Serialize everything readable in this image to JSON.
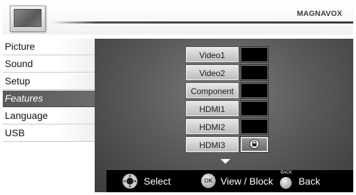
{
  "header": {
    "brand": "MAGNAVOX",
    "tv_icon": "tv-icon"
  },
  "menu": {
    "items": [
      {
        "label": "Picture",
        "selected": false
      },
      {
        "label": "Sound",
        "selected": false
      },
      {
        "label": "Setup",
        "selected": false
      },
      {
        "label": "Features",
        "selected": true
      },
      {
        "label": "Language",
        "selected": false
      },
      {
        "label": "USB",
        "selected": false
      }
    ]
  },
  "sources": {
    "items": [
      {
        "label": "Video1",
        "blocked": false
      },
      {
        "label": "Video2",
        "blocked": false
      },
      {
        "label": "Component",
        "blocked": false
      },
      {
        "label": "HDMI1",
        "blocked": false
      },
      {
        "label": "HDMI2",
        "blocked": false
      },
      {
        "label": "HDMI3",
        "blocked": true,
        "highlighted": true
      }
    ],
    "more_indicator": "chevron-down-icon",
    "block_icon": "lock-icon"
  },
  "footer": {
    "select_label": "Select",
    "ok_label": "OK",
    "view_block_label": "View / Block",
    "back_tag": "BACK",
    "back_label": "Back"
  },
  "colors": {
    "panel": "#5c5c5c",
    "selected_menu": "#5a5a5a",
    "footer": "#000000"
  }
}
